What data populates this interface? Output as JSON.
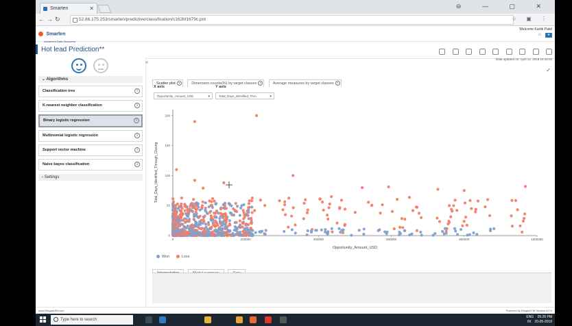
{
  "browser": {
    "tab_title": "Smarten",
    "url": "52.66.175.253/smarten/predictive/classification/c162bf1679c.pnt",
    "window_controls": "⊖ — ▢ ✕"
  },
  "app": {
    "logo_text": "Smarten",
    "logo_subtext": "Advanced Data Discovery",
    "welcome": "Welcome Kartik Patel",
    "page_title": "Hot lead Prediction**",
    "data_updated": "Data updated on: April 12, 2018 15:40:02"
  },
  "left_panel": {
    "section": "Algorithms",
    "algorithms": [
      {
        "label": "Classification tree"
      },
      {
        "label": "K-nearest neighbor classification"
      },
      {
        "label": "Binary logistic regression",
        "selected": true
      },
      {
        "label": "Multinomial logistic regression"
      },
      {
        "label": "Support vector machine"
      },
      {
        "label": "Naive bayes classification"
      }
    ],
    "settings": "Settings"
  },
  "tabs": {
    "scatter": "Scatter plot",
    "dimension": "Dimension counts(%) by target classes",
    "average": "Average measures by target classes"
  },
  "axes": {
    "x_label": "X axis",
    "y_label": "Y axis",
    "x_value": "Opportunity_Amount_USD",
    "y_value": "Total_Days_Identified_Thro"
  },
  "chart_data": {
    "type": "scatter",
    "xlabel": "Opportunity_Amount_USD",
    "ylabel": "Total_Days_Identified_Through_Closing",
    "xlim": [
      0,
      1000000
    ],
    "ylim": [
      0,
      210
    ],
    "x_ticks": [
      "0",
      "200000",
      "400000",
      "600000",
      "800000",
      "1000000"
    ],
    "y_ticks": [
      "0",
      "50",
      "100",
      "150",
      "200"
    ],
    "series": [
      {
        "name": "Won",
        "color": "#7ea1cc"
      },
      {
        "name": "Loss",
        "color": "#f47d67"
      }
    ]
  },
  "legend": {
    "won": "Won",
    "loss": "Loss"
  },
  "bottom_tabs": {
    "interpretation": "Interpretation",
    "model": "Model summary",
    "data": "Data"
  },
  "footer": {
    "left": "www.ElegantJBI.com",
    "right": "Powered by ElegantJ BI Version 4.0.0"
  },
  "taskbar": {
    "search_placeholder": "Type here to search",
    "lang": "ENG",
    "region": "IN",
    "time": "05:26 PM",
    "date": "20-05-2018"
  }
}
